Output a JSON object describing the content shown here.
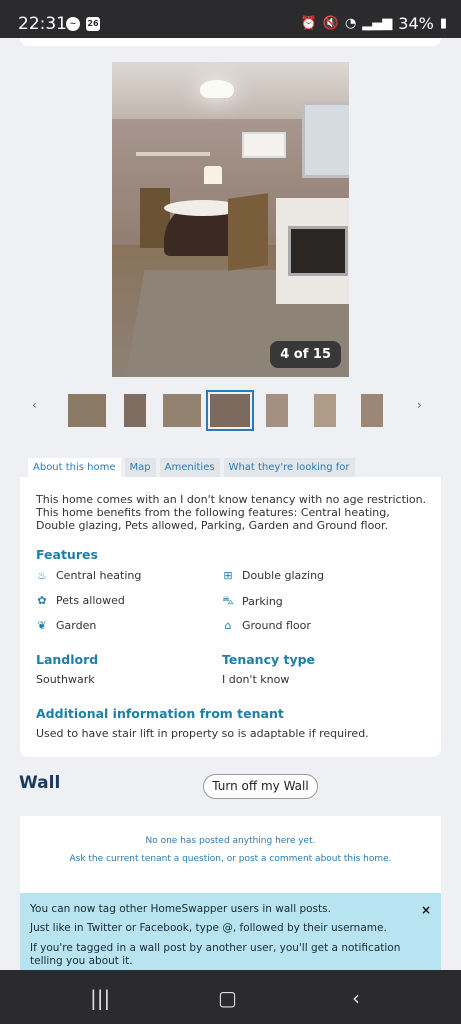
{
  "status_bar": {
    "time": "22:31",
    "calendar_day": "26",
    "battery": "34%"
  },
  "gallery": {
    "counter": "4 of 15",
    "thumbnail_count": 7,
    "active_thumbnail": 4
  },
  "tabs": [
    {
      "label": "About this home",
      "active": true
    },
    {
      "label": "Map",
      "active": false
    },
    {
      "label": "Amenities",
      "active": false
    },
    {
      "label": "What they're looking for",
      "active": false
    }
  ],
  "about": {
    "description": "This home comes with an I don't know tenancy with no age restriction. This home benefits from the following features: Central heating, Double glazing, Pets allowed, Parking, Garden and Ground floor.",
    "features_title": "Features",
    "features": [
      {
        "label": "Central heating",
        "icon": "flame-icon"
      },
      {
        "label": "Double glazing",
        "icon": "window-icon"
      },
      {
        "label": "Pets allowed",
        "icon": "paw-icon"
      },
      {
        "label": "Parking",
        "icon": "car-icon"
      },
      {
        "label": "Garden",
        "icon": "plant-icon"
      },
      {
        "label": "Ground floor",
        "icon": "house-icon"
      }
    ],
    "landlord_title": "Landlord",
    "landlord_value": "Southwark",
    "tenancy_title": "Tenancy type",
    "tenancy_value": "I don't know",
    "additional_title": "Additional information from tenant",
    "additional_text": "Used to have stair lift in property so is adaptable if required."
  },
  "wall": {
    "title": "Wall",
    "turn_off_label": "Turn off my Wall",
    "empty_line1": "No one has posted anything here yet.",
    "empty_line2": "Ask the current tenant a question, or post a comment about this home."
  },
  "info_banner": {
    "line1": "You can now tag other HomeSwapper users in wall posts.",
    "line2": "Just like in Twitter or Facebook, type @, followed by their username.",
    "line3": "If you're tagged in a wall post by another user, you'll get a notification telling you about it.",
    "close_glyph": "×"
  },
  "colors": {
    "accent": "#1e7fa8",
    "link": "#2a7bb3",
    "heading": "#1a3a5c",
    "info_bg": "#b8e3f0"
  }
}
